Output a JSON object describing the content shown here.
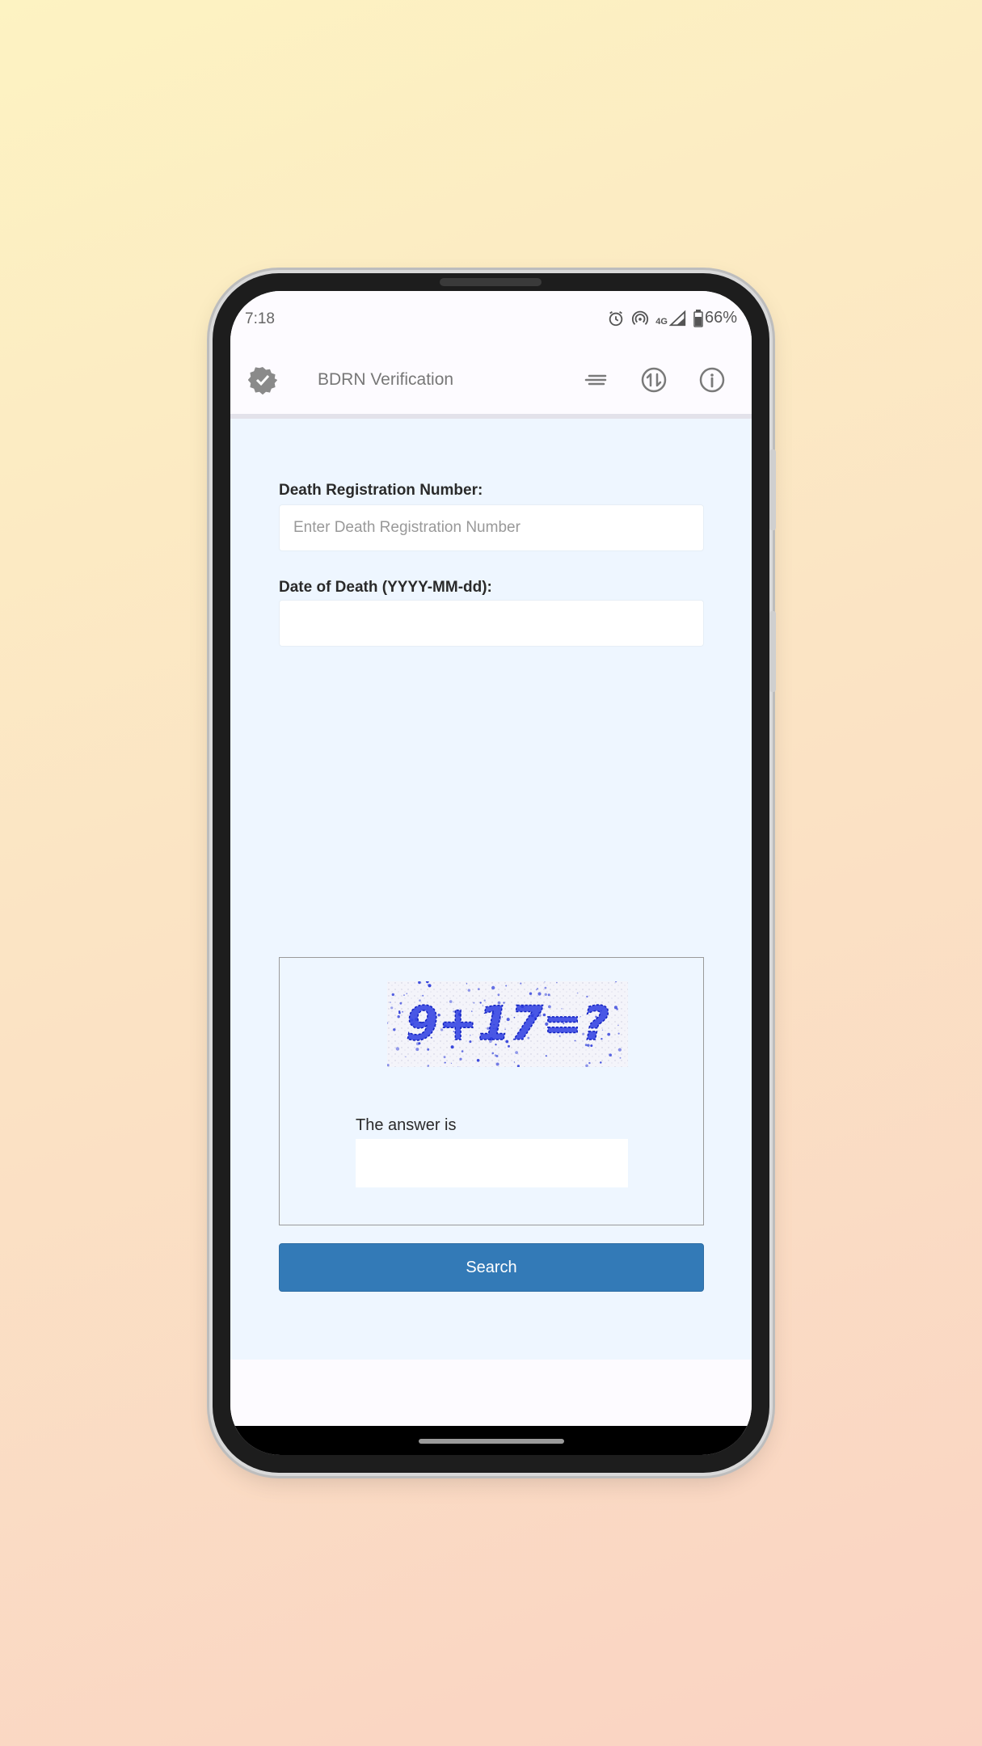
{
  "status_bar": {
    "time": "7:18",
    "network": "4G",
    "battery": "66%",
    "icons": [
      "alarm-icon",
      "hotspot-icon",
      "signal-icon",
      "battery-icon"
    ]
  },
  "app_bar": {
    "title": "BDRN Verification",
    "icons": [
      "verified-badge-icon",
      "menu-lines-icon",
      "swap-icon",
      "info-icon"
    ]
  },
  "form": {
    "registration_label": "Death Registration Number:",
    "registration_placeholder": "Enter Death Registration Number",
    "registration_value": "",
    "date_label": "Date of Death (YYYY-MM-dd):",
    "date_value": "",
    "captcha_text": "9+17=?",
    "answer_label": "The answer is",
    "answer_value": "",
    "search_label": "Search"
  },
  "colors": {
    "accent": "#337ab7",
    "content_bg": "#eef6ff",
    "captcha_text": "#2030d8"
  }
}
